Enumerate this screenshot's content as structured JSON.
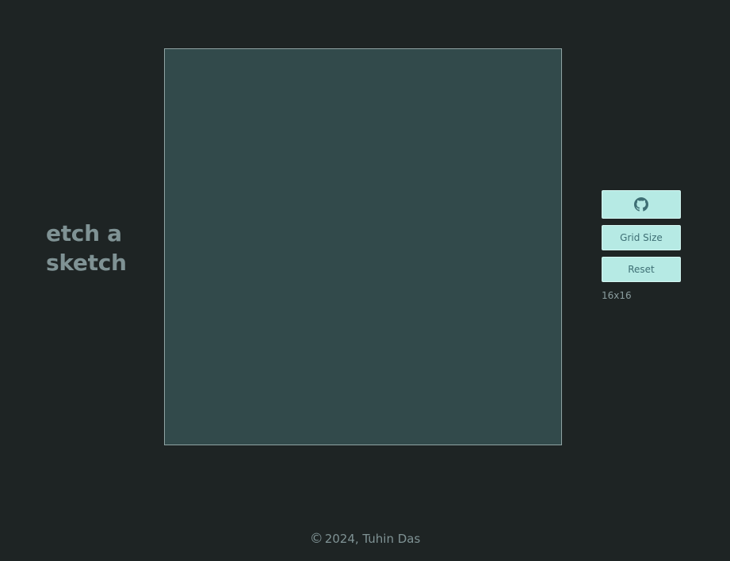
{
  "title": {
    "line1": "etch a",
    "line2": "sketch"
  },
  "canvas": {
    "color": "#324a4b"
  },
  "controls": {
    "github_icon": "github-icon",
    "grid_size_label": "Grid Size",
    "reset_label": "Reset",
    "grid_dimension": "16x16"
  },
  "footer": {
    "copyright_symbol": "©",
    "text": "2024, Tuhin Das"
  },
  "colors": {
    "background": "#1e2424",
    "button": "#b6eae4",
    "button_text": "#3e6f74",
    "title_text": "#7f9294"
  }
}
